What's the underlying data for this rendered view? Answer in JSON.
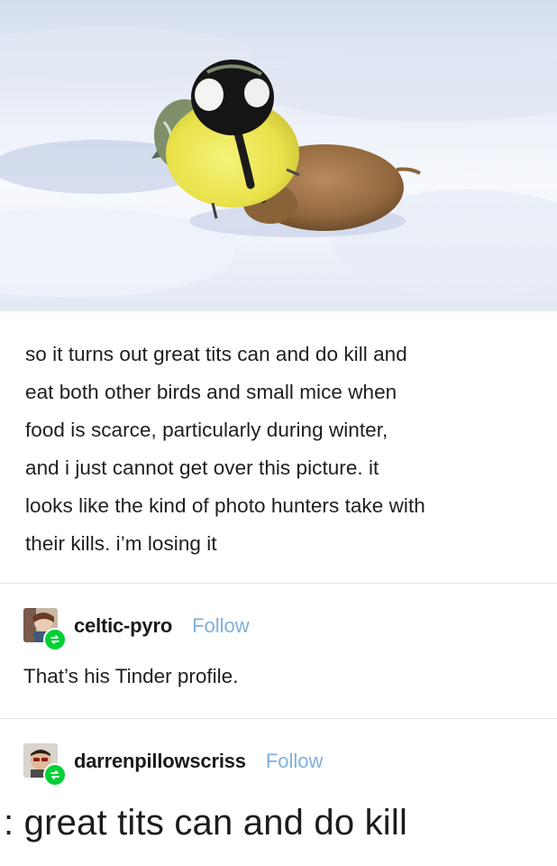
{
  "post": {
    "lines": [
      "so it turns out great tits can and do kill and",
      "eat both other birds and small mice when",
      "food is scarce, particularly during winter,",
      "and i just cannot get over this picture. it",
      "looks like the kind of photo hunters take with",
      "their kills. i’m losing it"
    ]
  },
  "reblogs": [
    {
      "username": "celtic-pyro",
      "follow_label": "Follow",
      "text": "That’s his Tinder profile."
    },
    {
      "username": "darrenpillowscriss",
      "follow_label": "Follow",
      "text": ": great tits can and do kill"
    }
  ],
  "colors": {
    "follow": "#7fb1da",
    "reblog_badge": "#00cf35"
  },
  "icons": {
    "reblog_badge": "reblog-icon"
  }
}
